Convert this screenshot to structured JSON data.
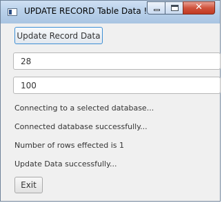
{
  "window": {
    "title": "UPDATE RECORD Table Data !",
    "icons": {
      "app": "window-icon",
      "minimize": "minimize-icon",
      "maximize": "maximize-icon",
      "close": "close-icon"
    },
    "close_glyph": "✕"
  },
  "form": {
    "update_button_label": "Update Record Data",
    "record_id_value": "28",
    "record_value": "100"
  },
  "messages": [
    "Connecting to a selected database...",
    "Connected database successfully...",
    "Number of rows effected is 1",
    "Update Data successfully..."
  ],
  "exit_button_label": "Exit",
  "colors": {
    "titlebar": "#b9d1ea",
    "close_button": "#c13a22",
    "focus_border": "#3d8fd4",
    "window_bg": "#f0f0f0"
  }
}
